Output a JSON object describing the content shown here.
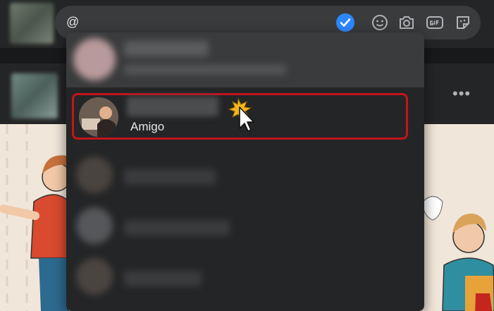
{
  "comment": {
    "input_value": "@"
  },
  "toolbar_icons": [
    "check-icon",
    "emoji-icon",
    "camera-icon",
    "gif-icon",
    "sticker-icon"
  ],
  "post": {
    "menu_label": "•••"
  },
  "mentions": [
    {
      "label": "",
      "state": "blurred"
    },
    {
      "label": "Amigo",
      "state": "selected-hover"
    },
    {
      "label": "",
      "state": "blurred"
    },
    {
      "label": "",
      "state": "blurred"
    },
    {
      "label": "",
      "state": "blurred"
    }
  ],
  "colors": {
    "accent": "#2d88ff",
    "highlight_border": "#c4141d",
    "panel": "#242526",
    "input": "#3a3b3c"
  }
}
